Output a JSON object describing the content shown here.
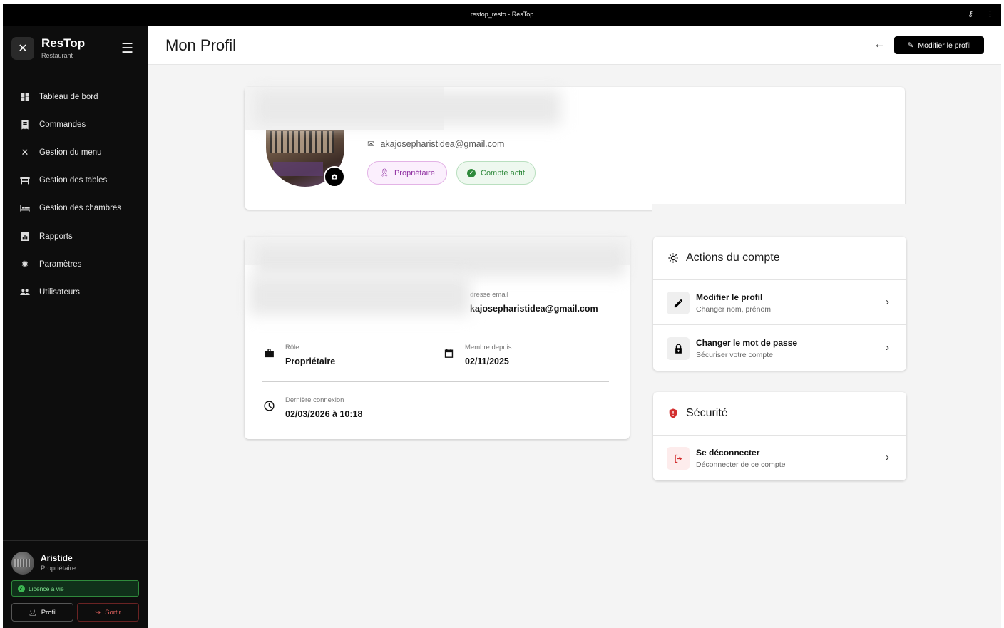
{
  "window": {
    "title": "restop_resto - ResTop",
    "key_icon": "key-icon",
    "more_icon": "more-vert-icon"
  },
  "sidebar": {
    "brand_name": "ResTop",
    "brand_sub": "Restaurant",
    "items": [
      {
        "label": "Tableau de bord",
        "icon": "dashboard-icon"
      },
      {
        "label": "Commandes",
        "icon": "receipt-icon"
      },
      {
        "label": "Gestion du menu",
        "icon": "utensils-icon"
      },
      {
        "label": "Gestion des tables",
        "icon": "table-icon"
      },
      {
        "label": "Gestion des chambres",
        "icon": "bed-icon"
      },
      {
        "label": "Rapports",
        "icon": "chart-icon"
      },
      {
        "label": "Paramètres",
        "icon": "gear-icon"
      },
      {
        "label": "Utilisateurs",
        "icon": "users-icon"
      }
    ],
    "user": {
      "name": "Aristide",
      "role": "Propriétaire"
    },
    "licence": "Licence à vie",
    "profil_button": "Profil",
    "sortir_button": "Sortir"
  },
  "header": {
    "title": "Mon Profil",
    "edit_button": "Modifier le profil"
  },
  "profile": {
    "email": "akajosepharistidea@gmail.com",
    "role_badge": "Propriétaire",
    "status_badge": "Compte actif"
  },
  "info": {
    "email_label": "dresse email",
    "email_value": "kajosepharistidea@gmail.com",
    "role_label": "Rôle",
    "role_value": "Propriétaire",
    "member_label": "Membre depuis",
    "member_value": "02/11/2025",
    "last_login_label": "Dernière connexion",
    "last_login_value": "02/03/2026 à 10:18"
  },
  "actions": {
    "title": "Actions du compte",
    "items": [
      {
        "title": "Modifier le profil",
        "subtitle": "Changer nom, prénom"
      },
      {
        "title": "Changer le mot de passe",
        "subtitle": "Sécuriser votre compte"
      }
    ]
  },
  "security": {
    "title": "Sécurité",
    "items": [
      {
        "title": "Se déconnecter",
        "subtitle": "Déconnecter de ce compte"
      }
    ]
  },
  "colors": {
    "accent": "#000000",
    "owner_badge": "#8e2fa0",
    "active_badge": "#2f8a3c",
    "danger": "#e2625f"
  }
}
